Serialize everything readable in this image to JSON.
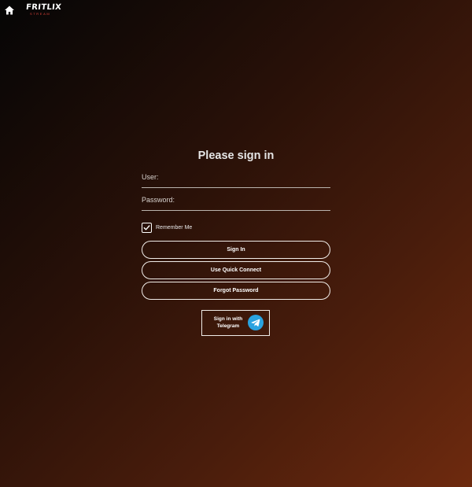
{
  "app": {
    "logo_text": "FRITLIX",
    "logo_subtext": "STREAM"
  },
  "login": {
    "title": "Please sign in",
    "user_label": "User:",
    "password_label": "Password:",
    "remember_label": "Remember Me",
    "remember_checked": true,
    "buttons": {
      "sign_in": "Sign In",
      "quick_connect": "Use Quick Connect",
      "forgot_password": "Forgot Password"
    },
    "telegram": {
      "line1": "Sign in with",
      "line2": "Telegram",
      "icon": "telegram-icon",
      "icon_color": "#2aa3e0"
    }
  },
  "colors": {
    "background_start": "#050505",
    "background_end": "#6e2a0e",
    "accent_logo": "#e0433a"
  },
  "icons": {
    "home": "home-icon",
    "checkbox": "checkmark-icon"
  }
}
